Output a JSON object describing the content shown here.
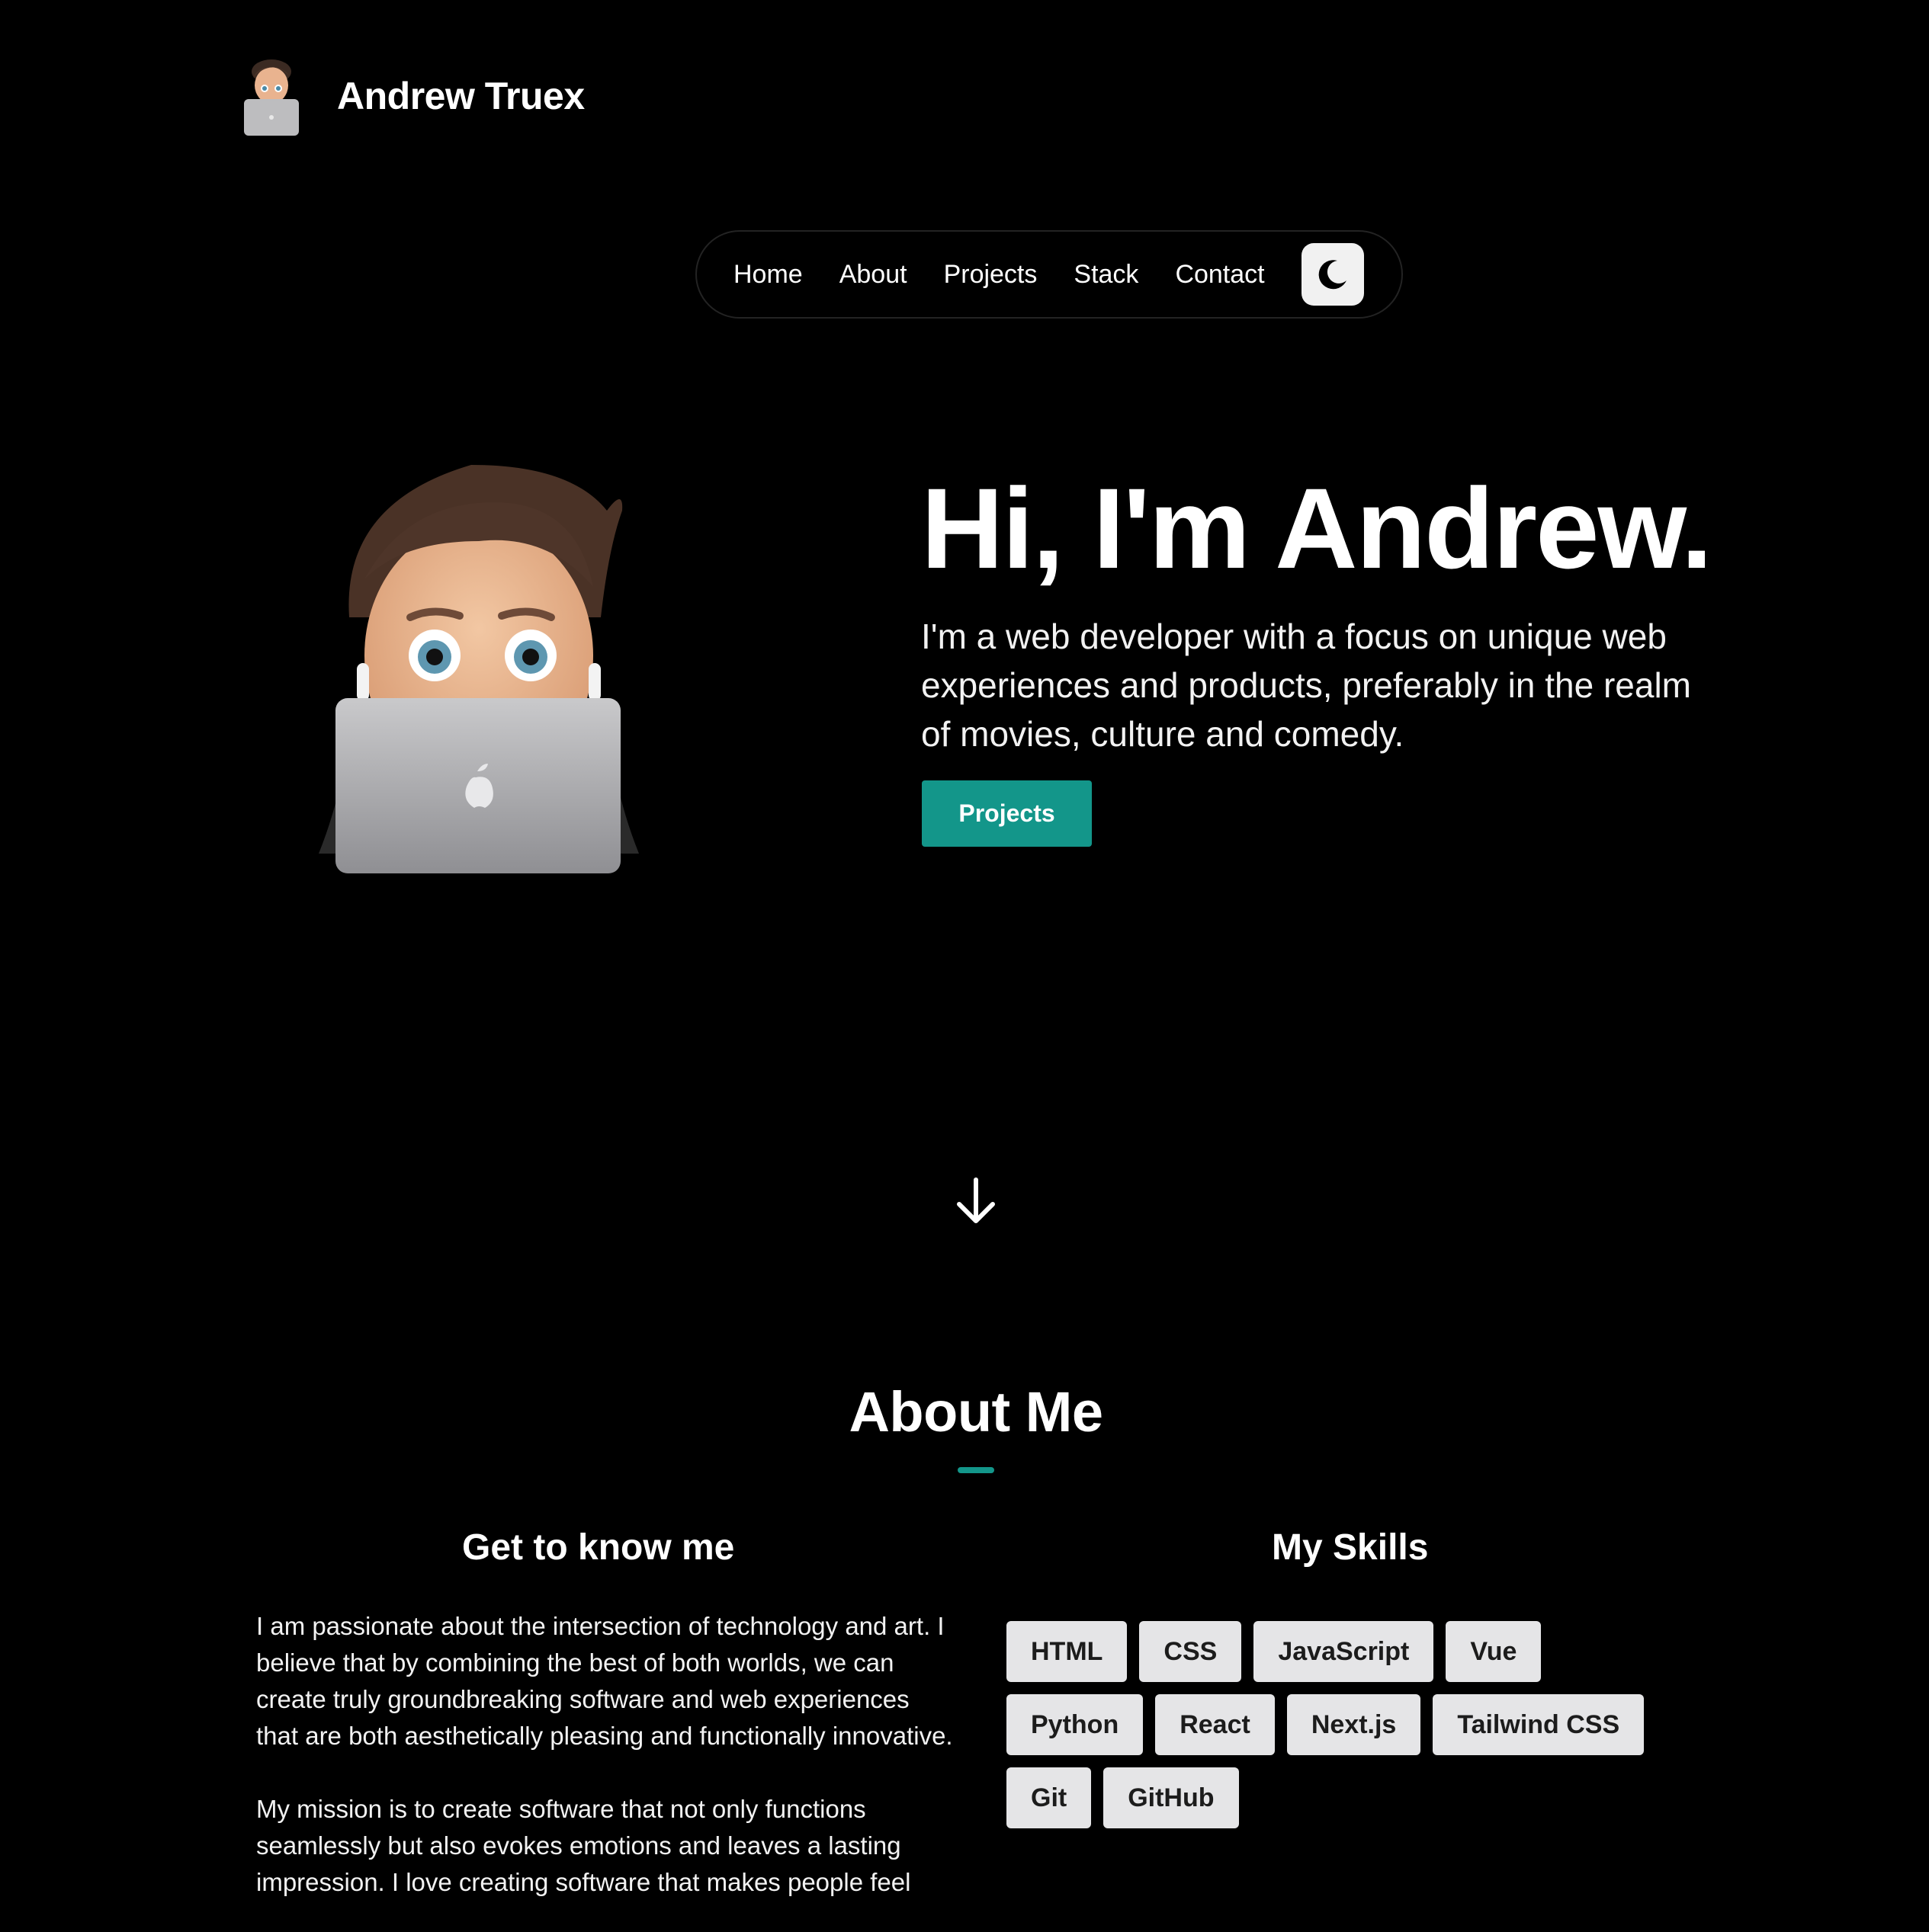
{
  "header": {
    "name": "Andrew Truex"
  },
  "nav": {
    "items": [
      {
        "label": "Home"
      },
      {
        "label": "About"
      },
      {
        "label": "Projects"
      },
      {
        "label": "Stack"
      },
      {
        "label": "Contact"
      }
    ],
    "theme_icon": "moon-icon"
  },
  "hero": {
    "title": "Hi, I'm Andrew.",
    "subtitle": "I'm a web developer with a focus on unique web experiences and products, preferably in the realm of movies, culture and comedy.",
    "cta_label": "Projects",
    "scroll_icon": "arrow-down-icon"
  },
  "about": {
    "title": "About Me",
    "left_title": "Get to know me",
    "paragraphs": [
      "I am passionate about the intersection of technology and art. I believe that by combining the best of both worlds, we can create truly groundbreaking software and web experiences that are both aesthetically pleasing and functionally innovative.",
      "My mission is to create software that not only functions seamlessly but also evokes emotions and leaves a lasting impression. I love creating software that makes people feel"
    ],
    "right_title": "My Skills",
    "skills": [
      "HTML",
      "CSS",
      "JavaScript",
      "Vue",
      "Python",
      "React",
      "Next.js",
      "Tailwind CSS",
      "Git",
      "GitHub"
    ]
  },
  "colors": {
    "background": "#000000",
    "accent": "#13968a",
    "chip": "#e5e5e7"
  }
}
